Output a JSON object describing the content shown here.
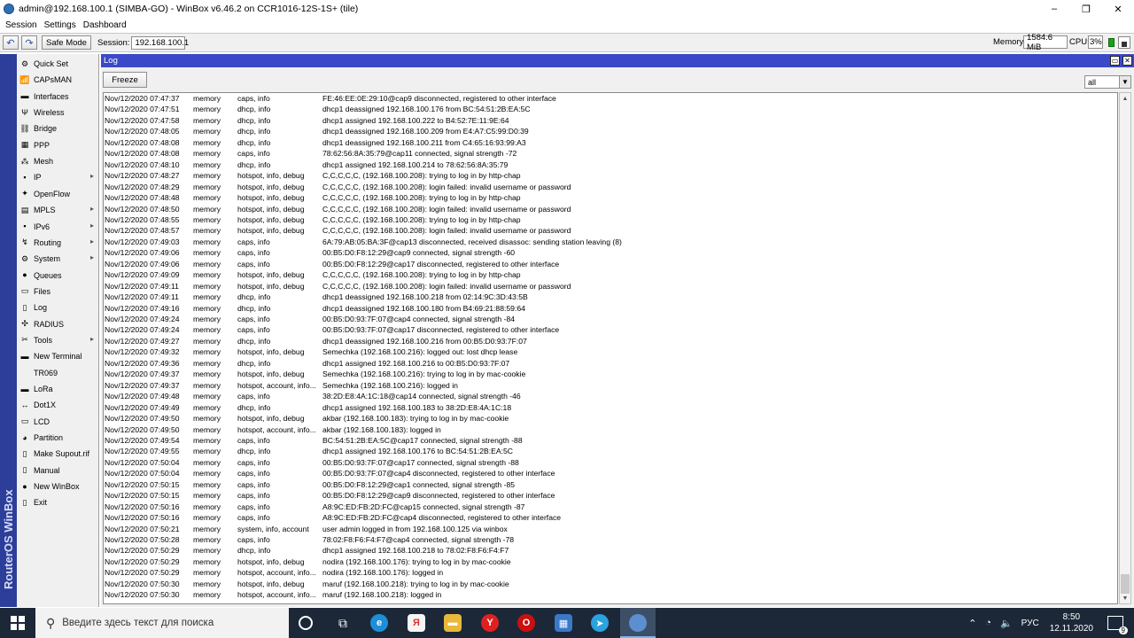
{
  "window": {
    "title": "admin@192.168.100.1 (SIMBA-GO) - WinBox v6.46.2 on CCR1016-12S-1S+ (tile)",
    "controls": [
      "–",
      "❐",
      "✕"
    ]
  },
  "menu": [
    "Session",
    "Settings",
    "Dashboard"
  ],
  "toolbar": {
    "undo_icon": "↶",
    "redo_icon": "↷",
    "safe_mode": "Safe Mode",
    "session_label": "Session:",
    "session_value": "192.168.100.1",
    "memory_label": "Memory:",
    "memory_value": "1584.6 MiB",
    "cpu_label": "CPU:",
    "cpu_value": "3%"
  },
  "sidebar": {
    "vertical_brand": "RouterOS WinBox",
    "items": [
      {
        "label": "Quick Set",
        "icon": "⚙",
        "arrow": false
      },
      {
        "label": "CAPsMAN",
        "icon": "📶",
        "arrow": false
      },
      {
        "label": "Interfaces",
        "icon": "▬",
        "arrow": false
      },
      {
        "label": "Wireless",
        "icon": "Ψ",
        "arrow": false
      },
      {
        "label": "Bridge",
        "icon": "⛓",
        "arrow": false
      },
      {
        "label": "PPP",
        "icon": "▦",
        "arrow": false
      },
      {
        "label": "Mesh",
        "icon": "⁂",
        "arrow": false
      },
      {
        "label": "IP",
        "icon": "▪",
        "arrow": true
      },
      {
        "label": "OpenFlow",
        "icon": "✦",
        "arrow": false
      },
      {
        "label": "MPLS",
        "icon": "▤",
        "arrow": true
      },
      {
        "label": "IPv6",
        "icon": "▪",
        "arrow": true
      },
      {
        "label": "Routing",
        "icon": "↯",
        "arrow": true
      },
      {
        "label": "System",
        "icon": "⚙",
        "arrow": true
      },
      {
        "label": "Queues",
        "icon": "●",
        "arrow": false
      },
      {
        "label": "Files",
        "icon": "▭",
        "arrow": false
      },
      {
        "label": "Log",
        "icon": "▯",
        "arrow": false
      },
      {
        "label": "RADIUS",
        "icon": "✣",
        "arrow": false
      },
      {
        "label": "Tools",
        "icon": "✂",
        "arrow": true
      },
      {
        "label": "New Terminal",
        "icon": "▬",
        "arrow": false
      },
      {
        "label": "TR069",
        "icon": "",
        "arrow": false
      },
      {
        "label": "LoRa",
        "icon": "▬",
        "arrow": false
      },
      {
        "label": "Dot1X",
        "icon": "↔",
        "arrow": false
      },
      {
        "label": "LCD",
        "icon": "▭",
        "arrow": false
      },
      {
        "label": "Partition",
        "icon": "◕",
        "arrow": false
      },
      {
        "label": "Make Supout.rif",
        "icon": "▯",
        "arrow": false
      },
      {
        "label": "Manual",
        "icon": "▯",
        "arrow": false
      },
      {
        "label": "New WinBox",
        "icon": "●",
        "arrow": false
      },
      {
        "label": "Exit",
        "icon": "▯",
        "arrow": false
      }
    ]
  },
  "log_window": {
    "title": "Log",
    "freeze_label": "Freeze",
    "filter_value": "all",
    "rows": [
      {
        "time": "Nov/12/2020 07:47:37",
        "buffer": "memory",
        "topics": "caps, info",
        "message": "FE:46:EE:0E:29:10@cap9 disconnected, registered to other interface"
      },
      {
        "time": "Nov/12/2020 07:47:51",
        "buffer": "memory",
        "topics": "dhcp, info",
        "message": "dhcp1 deassigned 192.168.100.176 from BC:54:51:2B:EA:5C"
      },
      {
        "time": "Nov/12/2020 07:47:58",
        "buffer": "memory",
        "topics": "dhcp, info",
        "message": "dhcp1 assigned 192.168.100.222 to B4:52:7E:11:9E:64"
      },
      {
        "time": "Nov/12/2020 07:48:05",
        "buffer": "memory",
        "topics": "dhcp, info",
        "message": "dhcp1 deassigned 192.168.100.209 from E4:A7:C5:99:D0:39"
      },
      {
        "time": "Nov/12/2020 07:48:08",
        "buffer": "memory",
        "topics": "dhcp, info",
        "message": "dhcp1 deassigned 192.168.100.211 from C4:65:16:93:99:A3"
      },
      {
        "time": "Nov/12/2020 07:48:08",
        "buffer": "memory",
        "topics": "caps, info",
        "message": "78:62:56:8A:35:79@cap11 connected, signal strength -72"
      },
      {
        "time": "Nov/12/2020 07:48:10",
        "buffer": "memory",
        "topics": "dhcp, info",
        "message": "dhcp1 assigned 192.168.100.214 to 78:62:56:8A:35:79"
      },
      {
        "time": "Nov/12/2020 07:48:27",
        "buffer": "memory",
        "topics": "hotspot, info, debug",
        "message": "C,C,C,C,C, (192.168.100.208): trying to log in by http-chap"
      },
      {
        "time": "Nov/12/2020 07:48:29",
        "buffer": "memory",
        "topics": "hotspot, info, debug",
        "message": "C,C,C,C,C, (192.168.100.208): login failed: invalid username or password"
      },
      {
        "time": "Nov/12/2020 07:48:48",
        "buffer": "memory",
        "topics": "hotspot, info, debug",
        "message": "C,C,C,C,C, (192.168.100.208): trying to log in by http-chap"
      },
      {
        "time": "Nov/12/2020 07:48:50",
        "buffer": "memory",
        "topics": "hotspot, info, debug",
        "message": "C,C,C,C,C, (192.168.100.208): login failed: invalid username or password"
      },
      {
        "time": "Nov/12/2020 07:48:55",
        "buffer": "memory",
        "topics": "hotspot, info, debug",
        "message": "C,C,C,C,C, (192.168.100.208): trying to log in by http-chap"
      },
      {
        "time": "Nov/12/2020 07:48:57",
        "buffer": "memory",
        "topics": "hotspot, info, debug",
        "message": "C,C,C,C,C, (192.168.100.208): login failed: invalid username or password"
      },
      {
        "time": "Nov/12/2020 07:49:03",
        "buffer": "memory",
        "topics": "caps, info",
        "message": "6A:79:AB:05:BA:3F@cap13 disconnected, received disassoc: sending station leaving (8)"
      },
      {
        "time": "Nov/12/2020 07:49:06",
        "buffer": "memory",
        "topics": "caps, info",
        "message": "00:B5:D0:F8:12:29@cap9 connected, signal strength -60"
      },
      {
        "time": "Nov/12/2020 07:49:06",
        "buffer": "memory",
        "topics": "caps, info",
        "message": "00:B5:D0:F8:12:29@cap17 disconnected, registered to other interface"
      },
      {
        "time": "Nov/12/2020 07:49:09",
        "buffer": "memory",
        "topics": "hotspot, info, debug",
        "message": "C,C,C,C,C, (192.168.100.208): trying to log in by http-chap"
      },
      {
        "time": "Nov/12/2020 07:49:11",
        "buffer": "memory",
        "topics": "hotspot, info, debug",
        "message": "C,C,C,C,C, (192.168.100.208): login failed: invalid username or password"
      },
      {
        "time": "Nov/12/2020 07:49:11",
        "buffer": "memory",
        "topics": "dhcp, info",
        "message": "dhcp1 deassigned 192.168.100.218 from 02:14:9C:3D:43:5B"
      },
      {
        "time": "Nov/12/2020 07:49:16",
        "buffer": "memory",
        "topics": "dhcp, info",
        "message": "dhcp1 deassigned 192.168.100.180 from B4:69:21:88:59:64"
      },
      {
        "time": "Nov/12/2020 07:49:24",
        "buffer": "memory",
        "topics": "caps, info",
        "message": "00:B5:D0:93:7F:07@cap4 connected, signal strength -84"
      },
      {
        "time": "Nov/12/2020 07:49:24",
        "buffer": "memory",
        "topics": "caps, info",
        "message": "00:B5:D0:93:7F:07@cap17 disconnected, registered to other interface"
      },
      {
        "time": "Nov/12/2020 07:49:27",
        "buffer": "memory",
        "topics": "dhcp, info",
        "message": "dhcp1 deassigned 192.168.100.216 from 00:B5:D0:93:7F:07"
      },
      {
        "time": "Nov/12/2020 07:49:32",
        "buffer": "memory",
        "topics": "hotspot, info, debug",
        "message": "Semechka (192.168.100.216): logged out: lost dhcp lease"
      },
      {
        "time": "Nov/12/2020 07:49:36",
        "buffer": "memory",
        "topics": "dhcp, info",
        "message": "dhcp1 assigned 192.168.100.216 to 00:B5:D0:93:7F:07"
      },
      {
        "time": "Nov/12/2020 07:49:37",
        "buffer": "memory",
        "topics": "hotspot, info, debug",
        "message": "Semechka (192.168.100.216): trying to log in by mac-cookie"
      },
      {
        "time": "Nov/12/2020 07:49:37",
        "buffer": "memory",
        "topics": "hotspot, account, info...",
        "message": "Semechka (192.168.100.216): logged in"
      },
      {
        "time": "Nov/12/2020 07:49:48",
        "buffer": "memory",
        "topics": "caps, info",
        "message": "38:2D:E8:4A:1C:18@cap14 connected, signal strength -46"
      },
      {
        "time": "Nov/12/2020 07:49:49",
        "buffer": "memory",
        "topics": "dhcp, info",
        "message": "dhcp1 assigned 192.168.100.183 to 38:2D:E8:4A:1C:18"
      },
      {
        "time": "Nov/12/2020 07:49:50",
        "buffer": "memory",
        "topics": "hotspot, info, debug",
        "message": "akbar (192.168.100.183): trying to log in by mac-cookie"
      },
      {
        "time": "Nov/12/2020 07:49:50",
        "buffer": "memory",
        "topics": "hotspot, account, info...",
        "message": "akbar (192.168.100.183): logged in"
      },
      {
        "time": "Nov/12/2020 07:49:54",
        "buffer": "memory",
        "topics": "caps, info",
        "message": "BC:54:51:2B:EA:5C@cap17 connected, signal strength -88"
      },
      {
        "time": "Nov/12/2020 07:49:55",
        "buffer": "memory",
        "topics": "dhcp, info",
        "message": "dhcp1 assigned 192.168.100.176 to BC:54:51:2B:EA:5C"
      },
      {
        "time": "Nov/12/2020 07:50:04",
        "buffer": "memory",
        "topics": "caps, info",
        "message": "00:B5:D0:93:7F:07@cap17 connected, signal strength -88"
      },
      {
        "time": "Nov/12/2020 07:50:04",
        "buffer": "memory",
        "topics": "caps, info",
        "message": "00:B5:D0:93:7F:07@cap4 disconnected, registered to other interface"
      },
      {
        "time": "Nov/12/2020 07:50:15",
        "buffer": "memory",
        "topics": "caps, info",
        "message": "00:B5:D0:F8:12:29@cap1 connected, signal strength -85"
      },
      {
        "time": "Nov/12/2020 07:50:15",
        "buffer": "memory",
        "topics": "caps, info",
        "message": "00:B5:D0:F8:12:29@cap9 disconnected, registered to other interface"
      },
      {
        "time": "Nov/12/2020 07:50:16",
        "buffer": "memory",
        "topics": "caps, info",
        "message": "A8:9C:ED:FB:2D:FC@cap15 connected, signal strength -87"
      },
      {
        "time": "Nov/12/2020 07:50:16",
        "buffer": "memory",
        "topics": "caps, info",
        "message": "A8:9C:ED:FB:2D:FC@cap4 disconnected, registered to other interface"
      },
      {
        "time": "Nov/12/2020 07:50:21",
        "buffer": "memory",
        "topics": "system, info, account",
        "message": "user admin logged in from 192.168.100.125 via winbox"
      },
      {
        "time": "Nov/12/2020 07:50:28",
        "buffer": "memory",
        "topics": "caps, info",
        "message": "78:02:F8:F6:F4:F7@cap4 connected, signal strength -78"
      },
      {
        "time": "Nov/12/2020 07:50:29",
        "buffer": "memory",
        "topics": "dhcp, info",
        "message": "dhcp1 assigned 192.168.100.218 to 78:02:F8:F6:F4:F7"
      },
      {
        "time": "Nov/12/2020 07:50:29",
        "buffer": "memory",
        "topics": "hotspot, info, debug",
        "message": "nodira (192.168.100.176): trying to log in by mac-cookie"
      },
      {
        "time": "Nov/12/2020 07:50:29",
        "buffer": "memory",
        "topics": "hotspot, account, info...",
        "message": "nodira (192.168.100.176): logged in"
      },
      {
        "time": "Nov/12/2020 07:50:30",
        "buffer": "memory",
        "topics": "hotspot, info, debug",
        "message": "maruf (192.168.100.218): trying to log in by mac-cookie"
      },
      {
        "time": "Nov/12/2020 07:50:30",
        "buffer": "memory",
        "topics": "hotspot, account, info...",
        "message": "maruf (192.168.100.218): logged in"
      }
    ]
  },
  "taskbar": {
    "search_placeholder": "Введите здесь текст для поиска",
    "language": "РУС",
    "time": "8:50",
    "date": "12.11.2020",
    "notification_count": "9"
  },
  "colors": {
    "window_title": "#3b49c8",
    "sidebar_strip": "#2c3e9a",
    "taskbar": "#1c2838"
  }
}
